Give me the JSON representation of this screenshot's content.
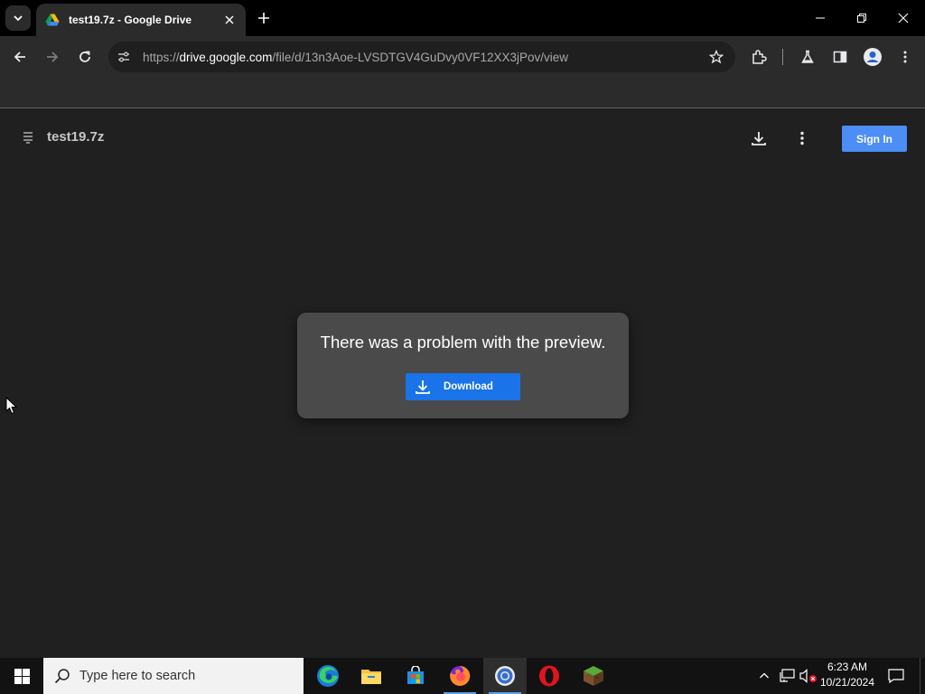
{
  "browser": {
    "tab_title": "test19.7z - Google Drive",
    "url_scheme": "https://",
    "url_host": "drive.google.com",
    "url_path": "/file/d/13n3Aoe-LVSDTGV4GuDvy0VF12XX3jPov/view"
  },
  "viewer": {
    "file_name": "test19.7z",
    "sign_in_label": "Sign In",
    "error_message": "There was a problem with the preview.",
    "download_label": "Download"
  },
  "taskbar": {
    "search_placeholder": "Type here to search",
    "time": "6:23 AM",
    "date": "10/21/2024",
    "apps": [
      "edge-icon",
      "file-explorer-icon",
      "microsoft-store-icon",
      "firefox-icon",
      "chrome-icon",
      "opera-icon",
      "minecraft-icon"
    ]
  },
  "colors": {
    "accent_blue": "#1a73e8",
    "sign_in_blue": "#4c8df6",
    "background": "#202020"
  }
}
